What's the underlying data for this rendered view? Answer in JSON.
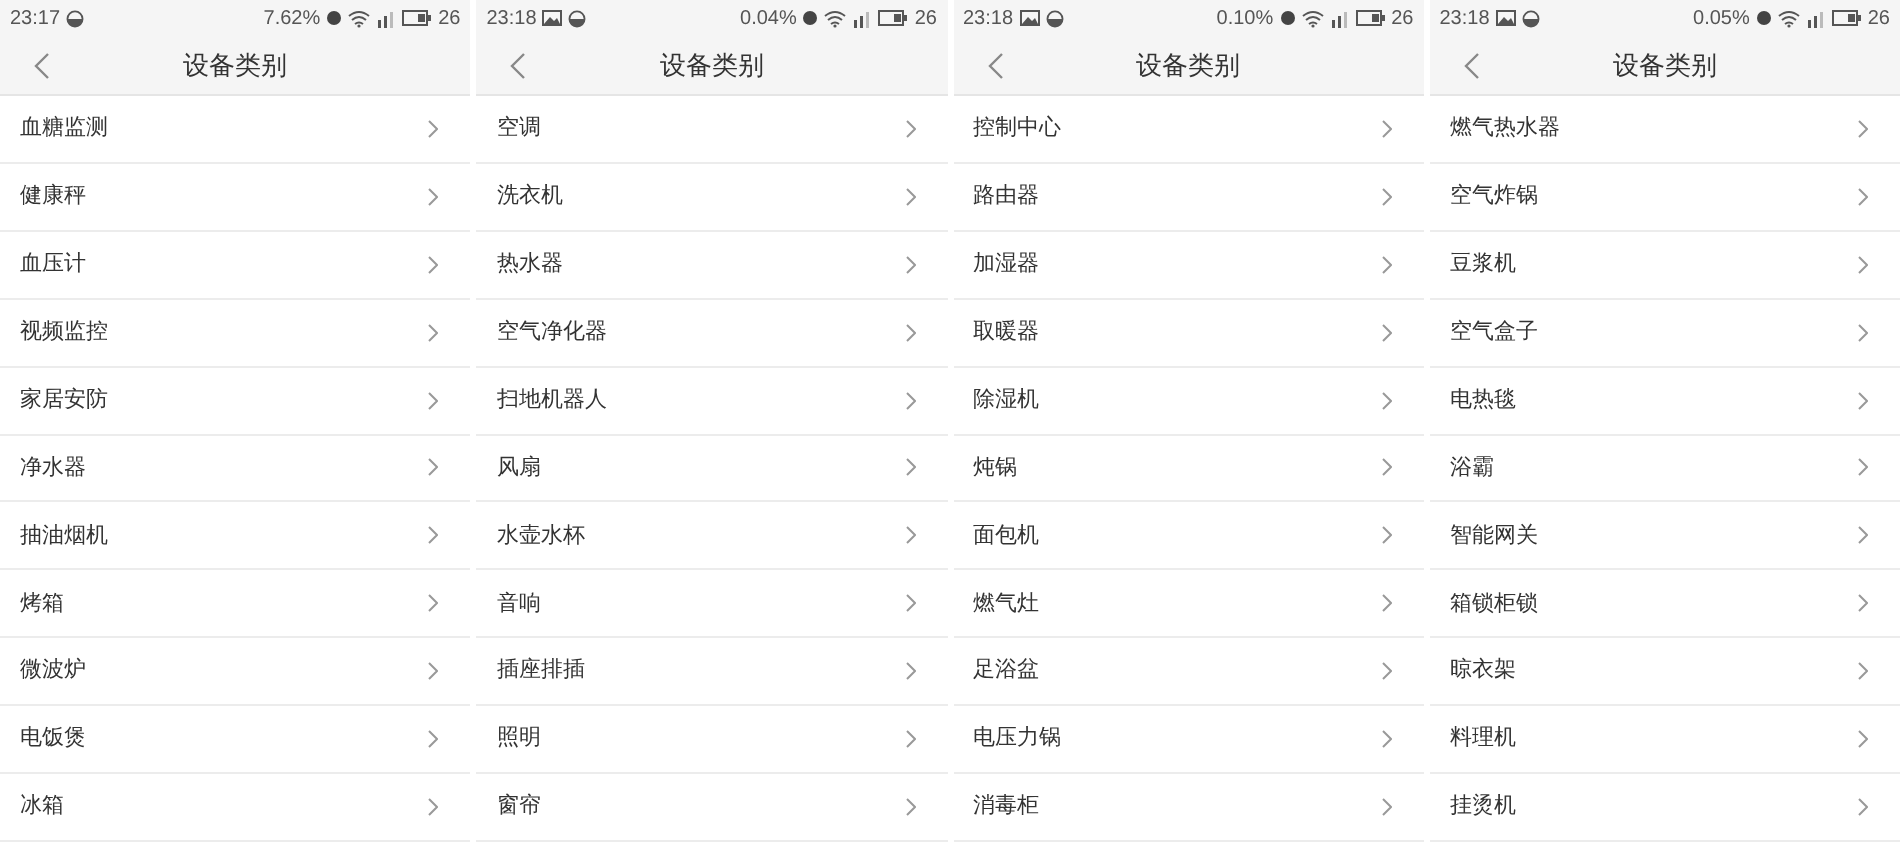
{
  "screens": [
    {
      "status_bar": {
        "time": "23:17",
        "notifications": [
          {
            "kind": "moon"
          }
        ],
        "speed": "7.62%",
        "battery": "26"
      },
      "header": {
        "title": "设备类别"
      },
      "items": [
        "血糖监测",
        "健康秤",
        "血压计",
        "视频监控",
        "家居安防",
        "净水器",
        "抽油烟机",
        "烤箱",
        "微波炉",
        "电饭煲",
        "冰箱"
      ]
    },
    {
      "status_bar": {
        "time": "23:18",
        "notifications": [
          {
            "kind": "image"
          },
          {
            "kind": "moon"
          }
        ],
        "speed": "0.04%",
        "battery": "26"
      },
      "header": {
        "title": "设备类别"
      },
      "items": [
        "空调",
        "洗衣机",
        "热水器",
        "空气净化器",
        "扫地机器人",
        "风扇",
        "水壶水杯",
        "音响",
        "插座排插",
        "照明",
        "窗帘"
      ]
    },
    {
      "status_bar": {
        "time": "23:18",
        "notifications": [
          {
            "kind": "image"
          },
          {
            "kind": "moon"
          }
        ],
        "speed": "0.10%",
        "battery": "26"
      },
      "header": {
        "title": "设备类别"
      },
      "items": [
        "控制中心",
        "路由器",
        "加湿器",
        "取暖器",
        "除湿机",
        "炖锅",
        "面包机",
        "燃气灶",
        "足浴盆",
        "电压力锅",
        "消毒柜"
      ]
    },
    {
      "status_bar": {
        "time": "23:18",
        "notifications": [
          {
            "kind": "image"
          },
          {
            "kind": "moon"
          }
        ],
        "speed": "0.05%",
        "battery": "26"
      },
      "header": {
        "title": "设备类别"
      },
      "items": [
        "燃气热水器",
        "空气炸锅",
        "豆浆机",
        "空气盒子",
        "电热毯",
        "浴霸",
        "智能网关",
        "箱锁柜锁",
        "晾衣架",
        "料理机",
        "挂烫机"
      ]
    }
  ]
}
